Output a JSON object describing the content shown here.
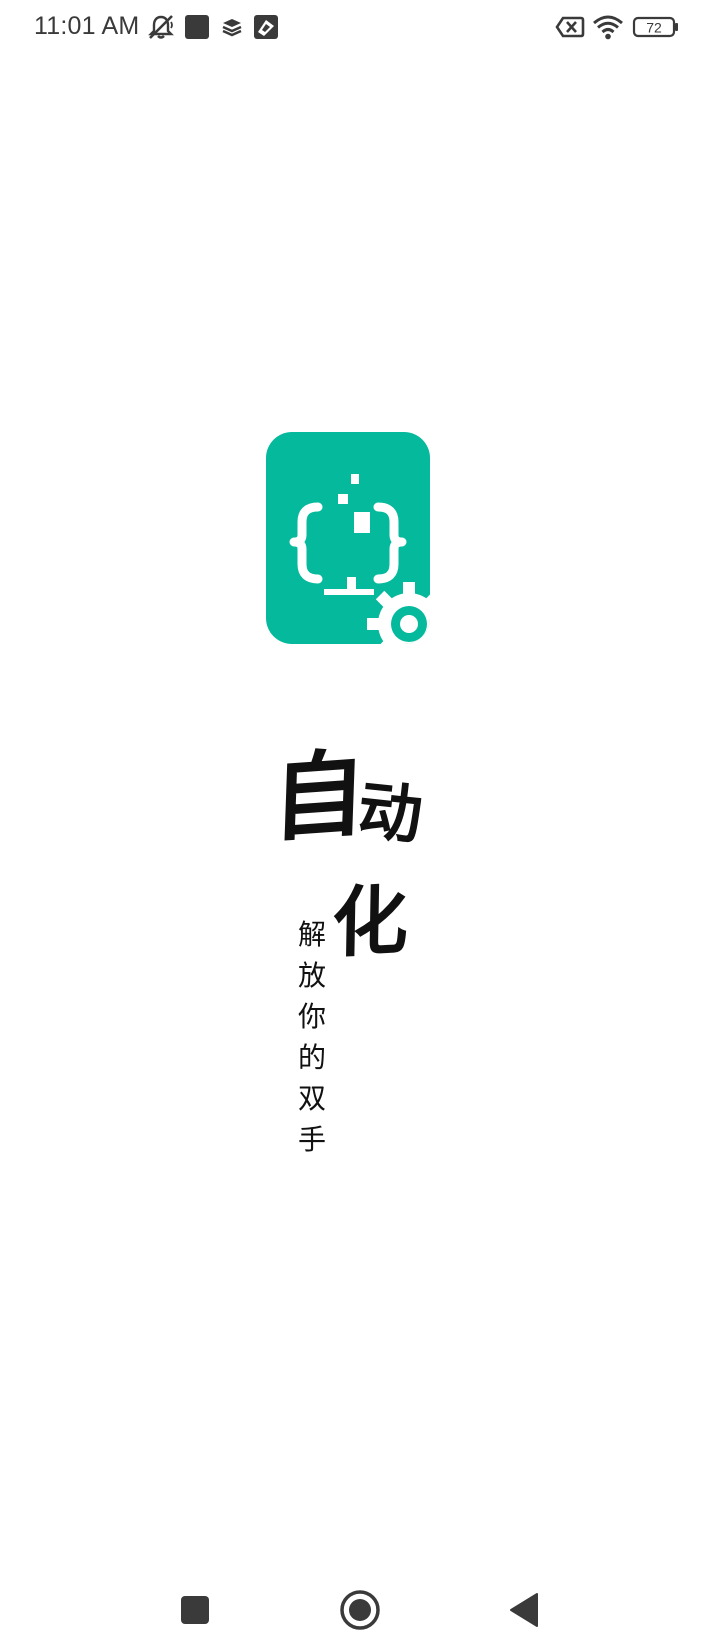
{
  "status_bar": {
    "time": "11:01 AM",
    "battery_level": "72",
    "icons": [
      "notifications-muted-icon",
      "app-square-icon",
      "layers-icon",
      "nav-app-icon",
      "data-off-icon",
      "wifi-icon",
      "battery-icon"
    ]
  },
  "app": {
    "logo_icon": "robot-monitor-gear-icon",
    "brand_color": "#05B99D",
    "title_char_1": "自",
    "title_char_2": "动",
    "title_char_3": "化",
    "tagline": "解放你的双手"
  },
  "nav_bar": {
    "recents_icon": "square-recents-icon",
    "home_icon": "circle-home-icon",
    "back_icon": "triangle-back-icon"
  }
}
